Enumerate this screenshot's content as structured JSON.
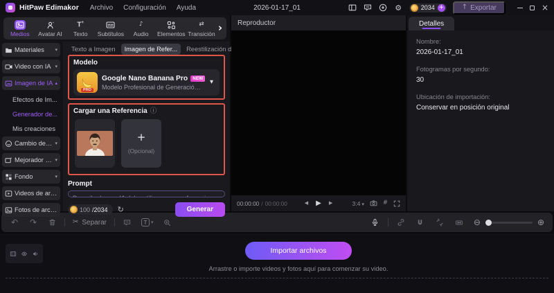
{
  "titlebar": {
    "app_name": "HitPaw Edimakor",
    "menus": [
      "Archivo",
      "Configuración",
      "Ayuda"
    ],
    "project_title": "2026-01-17_01",
    "coin_count": "2034",
    "export_label": "Exportar"
  },
  "top_tabs": {
    "items": [
      {
        "label": "Medios"
      },
      {
        "label": "Avatar AI"
      },
      {
        "label": "Texto"
      },
      {
        "label": "Subtítulos"
      },
      {
        "label": "Audio"
      },
      {
        "label": "Elementos"
      },
      {
        "label": "Transición"
      }
    ]
  },
  "sidebar": {
    "items": [
      {
        "label": "Materiales"
      },
      {
        "label": "Video con IA"
      },
      {
        "label": "Imagen de IA"
      },
      {
        "label": "Efectos de Im..."
      },
      {
        "label": "Generador de..."
      },
      {
        "label": "Mis creaciones"
      },
      {
        "label": "Cambio de ro..."
      },
      {
        "label": "Mejorador d..."
      },
      {
        "label": "Fondo"
      },
      {
        "label": "Videos de archivo"
      },
      {
        "label": "Fotos de archivo"
      }
    ]
  },
  "generator": {
    "tabs": [
      "Texto a Imagen",
      "Imagen de Refer...",
      "Reestilización de ..."
    ],
    "model_section": {
      "title": "Modelo",
      "model_name": "Google Nano Banana Pro",
      "model_badge": "NEW",
      "model_pro": "PRO",
      "model_desc": "Modelo Profesional de Generación de Imágen..."
    },
    "reference_section": {
      "title": "Cargar una Referencia",
      "plus_sign": "+",
      "optional_label": "(Opcional)"
    },
    "prompt_section": {
      "title": "Prompt",
      "placeholder": "Describa lo que IA debe utilizar como referencia y los cambios deseadosEjemplo: Cambiar el color a azul",
      "credits_used": "100",
      "credits_total": "/2034",
      "generate_label": "Generar"
    }
  },
  "player": {
    "title": "Reproductor",
    "time_current": "00:00:00",
    "time_separator": "/",
    "time_total": "00:00:00",
    "aspect_ratio": "3:4"
  },
  "details": {
    "tab_label": "Detalles",
    "fields": [
      {
        "label": "Nombre:",
        "value": "2026-01-17_01"
      },
      {
        "label": "Fotogramas por segundo:",
        "value": "30"
      },
      {
        "label": "Ubicación de importación:",
        "value": "Conservar en posición original"
      }
    ]
  },
  "timeline": {
    "separate_label": "Separar",
    "import_button_label": "Importar archivos",
    "drop_hint": "Arrastre o importe videos y fotos aquí para comenzar su video."
  },
  "icons": {
    "gear": "⚙",
    "info": "ⓘ",
    "refresh": "↻",
    "caret_down": "▾",
    "caret_up": "▴",
    "chevron_more": "›",
    "undo": "↶",
    "redo": "↷",
    "scissors": "✂",
    "music_note": "♪",
    "transition_arrows": "⇄",
    "minus_circle": "⊖",
    "plus_circle": "⊕",
    "plus": "+",
    "grid_hash": "#",
    "prev": "◀",
    "play": "▶",
    "next": "▶",
    "minimize": "−",
    "close": "×",
    "up_arrow": "↑"
  },
  "colors": {
    "accent_purple": "#9d5ff5",
    "annotation_red": "#e0554a",
    "coin_gold": "#f2b84b",
    "generate_gradient_start": "#8a4df0",
    "generate_gradient_end": "#b84bf0",
    "import_gradient_start": "#6f5bf5",
    "import_gradient_end": "#c04df2"
  }
}
